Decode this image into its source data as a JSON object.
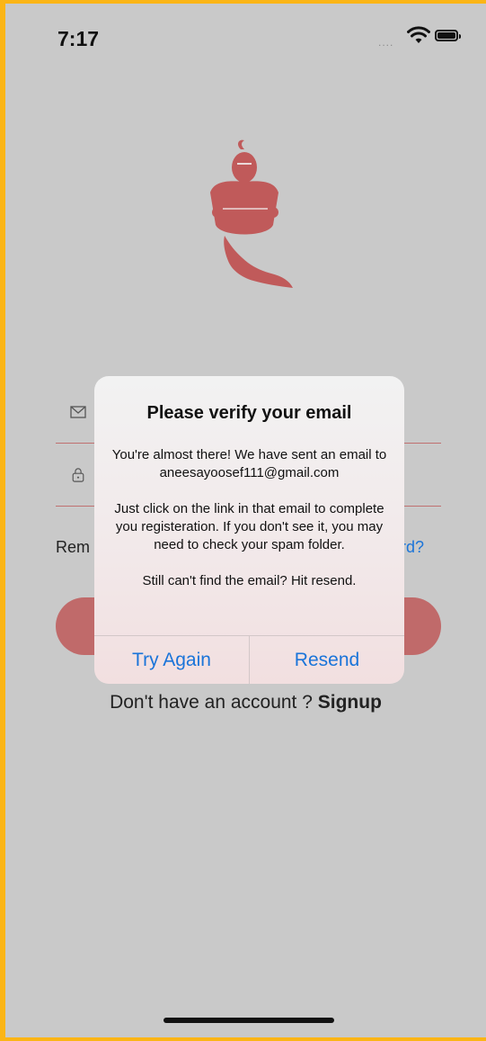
{
  "status_bar": {
    "time": "7:17",
    "signal": "....",
    "icons": [
      "wifi-icon",
      "battery-icon"
    ]
  },
  "logo": {
    "icon": "genie-logo",
    "color": "#c05a5a"
  },
  "form": {
    "email_icon": "envelope-icon",
    "password_icon": "lock-icon",
    "remember_label": "Rem",
    "forgot_label": "ord?",
    "login_button_color": "#c06a6a"
  },
  "signup": {
    "prompt": "Don't have an account ? ",
    "link": "Signup"
  },
  "alert": {
    "title": "Please verify your email",
    "message": "You're almost there! We have sent an email to aneesayoosef111@gmail.com\n\nJust click on the link in that email to complete you registeration. If you don't see it, you may need to check your spam folder.\n\nStill can't find the email? Hit resend.",
    "buttons": {
      "try_again": "Try Again",
      "resend": "Resend"
    }
  },
  "colors": {
    "accent": "#1a74d9",
    "brand": "#c05a5a",
    "dim_background": "#c9c9c9"
  }
}
